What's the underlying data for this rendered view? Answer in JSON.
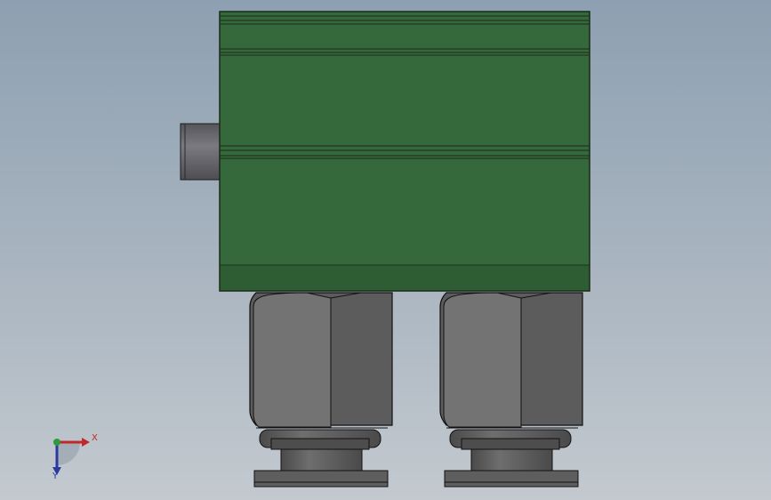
{
  "colors": {
    "housing_green": "#35683a",
    "housing_edge": "#1a2a1a",
    "fitting_gray_light": "#747474",
    "fitting_gray_dark": "#5a5a5a",
    "port_gray": "#6b6b70",
    "axis_x": "#c0282a",
    "axis_y": "#2a3aa0",
    "axis_z": "#2f9a3a"
  },
  "triad": {
    "x_label": "X",
    "y_label": "Y"
  }
}
